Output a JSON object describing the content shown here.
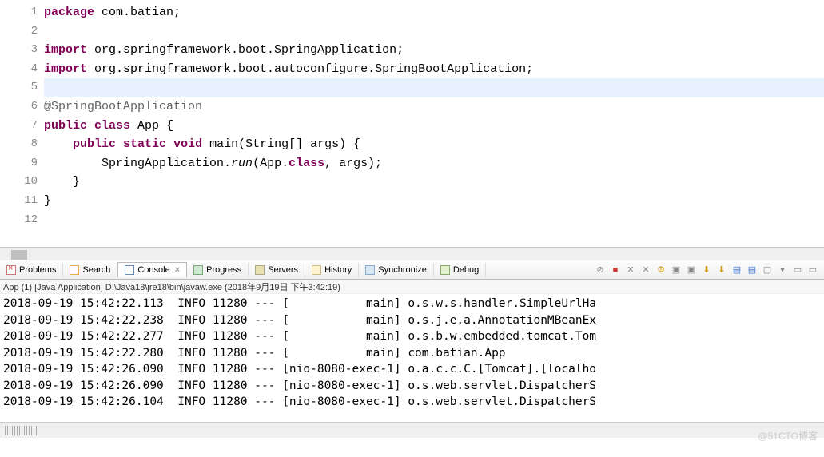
{
  "editor": {
    "lines": [
      {
        "n": "1",
        "html": "<span class='kw'>package</span> com.batian;"
      },
      {
        "n": "2",
        "html": ""
      },
      {
        "n": "3",
        "mark": true,
        "html": "<span class='kw'>import</span> org.springframework.boot.SpringApplication;"
      },
      {
        "n": "4",
        "html": "<span class='kw'>import</span> org.springframework.boot.autoconfigure.SpringBootApplication;"
      },
      {
        "n": "5",
        "hl": true,
        "html": ""
      },
      {
        "n": "6",
        "html": "<span class='ann'>@SpringBootApplication</span>"
      },
      {
        "n": "7",
        "html": "<span class='kw'>public</span> <span class='kw'>class</span> App {"
      },
      {
        "n": "8",
        "mark": true,
        "html": "    <span class='kw'>public</span> <span class='kw'>static</span> <span class='kw'>void</span> main(String[] args) {"
      },
      {
        "n": "9",
        "html": "        SpringApplication.<span class='mtd'>run</span>(App.<span class='kw'>class</span>, args);"
      },
      {
        "n": "10",
        "html": "    }"
      },
      {
        "n": "11",
        "html": "}"
      },
      {
        "n": "12",
        "html": ""
      }
    ]
  },
  "views": [
    {
      "label": "Problems",
      "icon": "ic-prob"
    },
    {
      "label": "Search",
      "icon": "ic-search"
    },
    {
      "label": "Console",
      "icon": "ic-console",
      "active": true,
      "closable": true
    },
    {
      "label": "Progress",
      "icon": "ic-progress"
    },
    {
      "label": "Servers",
      "icon": "ic-servers"
    },
    {
      "label": "History",
      "icon": "ic-history"
    },
    {
      "label": "Synchronize",
      "icon": "ic-sync"
    },
    {
      "label": "Debug",
      "icon": "ic-debug"
    }
  ],
  "toolbar": [
    "⊘",
    "■",
    "✕",
    "✕",
    "⚙",
    "▣",
    "▣",
    "⬇",
    "⬇",
    "▤",
    "▤",
    "▢",
    "▾",
    "▭",
    "▭"
  ],
  "console": {
    "header": "App (1) [Java Application] D:\\Java18\\jre18\\bin\\javaw.exe (2018年9月19日 下午3:42:19)",
    "rows": [
      {
        "ts": "2018-09-19 15:42:22.113",
        "lvl": "INFO",
        "pid": "11280",
        "thr": "[           main]",
        "src": "o.s.w.s.handler.SimpleUrlHa"
      },
      {
        "ts": "2018-09-19 15:42:22.238",
        "lvl": "INFO",
        "pid": "11280",
        "thr": "[           main]",
        "src": "o.s.j.e.a.AnnotationMBeanEx"
      },
      {
        "ts": "2018-09-19 15:42:22.277",
        "lvl": "INFO",
        "pid": "11280",
        "thr": "[           main]",
        "src": "o.s.b.w.embedded.tomcat.Tom"
      },
      {
        "ts": "2018-09-19 15:42:22.280",
        "lvl": "INFO",
        "pid": "11280",
        "thr": "[           main]",
        "src": "com.batian.App"
      },
      {
        "ts": "2018-09-19 15:42:26.090",
        "lvl": "INFO",
        "pid": "11280",
        "thr": "[nio-8080-exec-1]",
        "src": "o.a.c.c.C.[Tomcat].[localho"
      },
      {
        "ts": "2018-09-19 15:42:26.090",
        "lvl": "INFO",
        "pid": "11280",
        "thr": "[nio-8080-exec-1]",
        "src": "o.s.web.servlet.DispatcherS"
      },
      {
        "ts": "2018-09-19 15:42:26.104",
        "lvl": "INFO",
        "pid": "11280",
        "thr": "[nio-8080-exec-1]",
        "src": "o.s.web.servlet.DispatcherS"
      }
    ]
  },
  "watermark": "@51CTO博客"
}
